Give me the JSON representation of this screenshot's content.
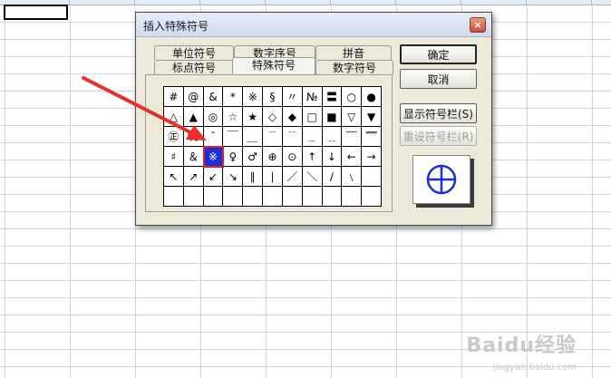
{
  "dialog": {
    "title": "插入特殊符号",
    "close_label": "×"
  },
  "tabs": {
    "row_back": [
      "单位符号",
      "数字序号",
      "拼音"
    ],
    "row_front": [
      "标点符号",
      "特殊符号",
      "数字符号"
    ],
    "active": "特殊符号"
  },
  "symbols": [
    [
      "#",
      "@",
      "&",
      "*",
      "※",
      "§",
      "〃",
      "№",
      "〓",
      "○",
      "●",
      "△"
    ],
    [
      "▲",
      "◎",
      "☆",
      "★",
      "◇",
      "◆",
      "□",
      "■",
      "▽",
      "▼",
      "㊣",
      "℅"
    ],
    [
      "ˉ",
      "￣",
      "＿",
      "﹉",
      "﹊",
      "﹍",
      "﹎",
      "﹋",
      "﹌",
      "♯",
      "＆",
      "※"
    ],
    [
      "♀",
      "♂",
      "⊕",
      "⊙",
      "↑",
      "↓",
      "←",
      "→",
      "↖",
      "↗",
      "↙",
      "↘"
    ],
    [
      "∥",
      "∣",
      "／",
      "＼",
      "∕",
      "﹨",
      "",
      "",
      "",
      "",
      "",
      ""
    ]
  ],
  "selected_symbol": "⊕",
  "buttons": {
    "ok": "确定",
    "cancel": "取消",
    "show_toolbar": "显示符号栏(S)",
    "reset_toolbar": "重设符号栏(R)"
  },
  "preview_symbol": "⊕",
  "watermark": {
    "brand": "Baidu经验",
    "url": "jingyan.baidu.com"
  },
  "colors": {
    "selected_bg": "#1a2fd8",
    "highlight": "#e02020",
    "preview_symbol": "#1a2fd8"
  }
}
